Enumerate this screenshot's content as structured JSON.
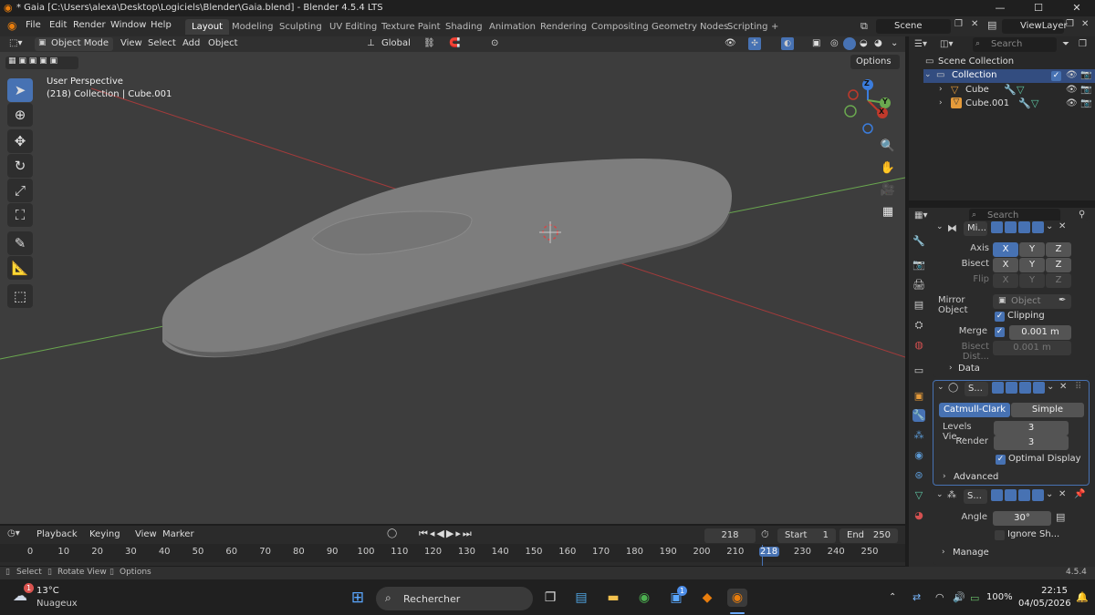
{
  "title_bar": {
    "title": "* Gaia [C:\\Users\\alexa\\Desktop\\Logiciels\\Blender\\Gaia.blend] - Blender 4.5.4 LTS",
    "minimize": "—",
    "maximize": "☐",
    "close": "✕"
  },
  "menu": [
    "File",
    "Edit",
    "Render",
    "Window",
    "Help"
  ],
  "workspaces": [
    "Layout",
    "Modeling",
    "Sculpting",
    "UV Editing",
    "Texture Paint",
    "Shading",
    "Animation",
    "Rendering",
    "Compositing",
    "Geometry Nodes",
    "Scripting"
  ],
  "workspace_add": "+",
  "scene": "Scene",
  "view_layer": "ViewLayer",
  "viewport_header": {
    "mode": "Object Mode",
    "menus": [
      "View",
      "Select",
      "Add",
      "Object"
    ],
    "orientation": "Global",
    "options": "Options"
  },
  "viewport": {
    "perspective": "User Perspective",
    "collection_info": "(218) Collection | Cube.001",
    "gizmo": {
      "z": "Z",
      "y": "Y",
      "x": "X"
    }
  },
  "outliner": {
    "search_placeholder": "Search",
    "scene_collection": "Scene Collection",
    "collection": "Collection",
    "objects": [
      "Cube",
      "Cube.001"
    ]
  },
  "properties": {
    "search_placeholder": "Search",
    "mirror": {
      "name": "Mi...",
      "axis_label": "Axis",
      "bisect_label": "Bisect",
      "flip_label": "Flip",
      "axes": [
        "X",
        "Y",
        "Z"
      ],
      "mirror_object_label": "Mirror Object",
      "mirror_object_placeholder": "Object",
      "clipping": "Clipping",
      "merge_label": "Merge",
      "merge_value": "0.001 m",
      "bisect_distance_label": "Bisect Dist...",
      "bisect_distance_value": "0.001 m",
      "data": "Data"
    },
    "subsurf": {
      "name": "S...",
      "catmull": "Catmull-Clark",
      "simple": "Simple",
      "levels_label": "Levels Vie...",
      "levels_value": "3",
      "render_label": "Render",
      "render_value": "3",
      "optimal_display": "Optimal Display",
      "advanced": "Advanced"
    },
    "smooth": {
      "name": "S...",
      "angle_label": "Angle",
      "angle_value": "30°",
      "ignore_sharp": "Ignore Sh...",
      "manage": "Manage"
    }
  },
  "timeline": {
    "playback": "Playback",
    "keying": "Keying",
    "view": "View",
    "marker": "Marker",
    "current_frame": "218",
    "start_label": "Start",
    "start": "1",
    "end_label": "End",
    "end": "250",
    "ticks": [
      "0",
      "10",
      "20",
      "30",
      "40",
      "50",
      "60",
      "70",
      "80",
      "90",
      "100",
      "110",
      "120",
      "130",
      "140",
      "150",
      "160",
      "170",
      "180",
      "190",
      "200",
      "210",
      "218",
      "230",
      "240",
      "250"
    ]
  },
  "status_bar": {
    "select": "Select",
    "rotate": "Rotate View",
    "options": "Options",
    "version": "4.5.4"
  },
  "taskbar": {
    "temperature": "13°C",
    "weather": "Nuageux",
    "weather_badge": "1",
    "search_placeholder": "Rechercher",
    "store_badge": "1",
    "battery": "100%",
    "time": "22:15",
    "date": "04/05/2026"
  },
  "colors": {
    "accent": "#4772b3",
    "viewport_bg": "#3d3d3d",
    "x_axis": "#c0392b",
    "y_axis": "#6aa84f",
    "z_axis": "#3b7ddd",
    "current_frame": "#4772b3"
  }
}
